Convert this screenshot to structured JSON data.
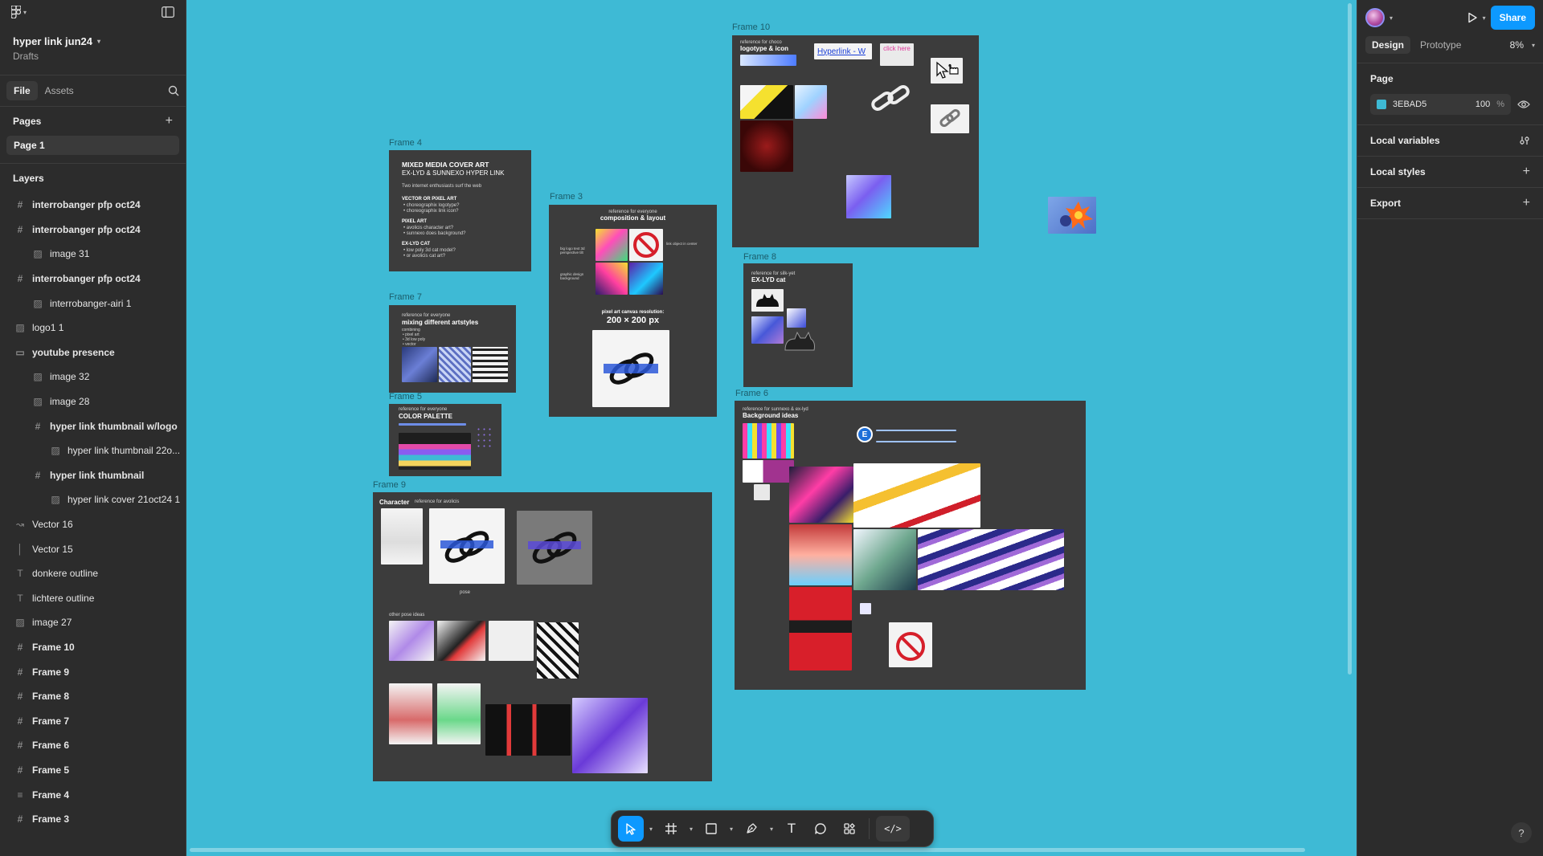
{
  "file": {
    "title": "hyper link jun24",
    "location": "Drafts"
  },
  "left_tabs": {
    "file": "File",
    "assets": "Assets"
  },
  "pages": {
    "header": "Pages",
    "items": [
      {
        "label": "Page 1"
      }
    ]
  },
  "layers": {
    "header": "Layers",
    "items": [
      {
        "label": "interrobanger pfp oct24",
        "icon": "frame-icon",
        "indent": 0
      },
      {
        "label": "interrobanger pfp oct24",
        "icon": "frame-icon",
        "indent": 0
      },
      {
        "label": "image 31",
        "icon": "image-icon",
        "indent": 1
      },
      {
        "label": "interrobanger pfp oct24",
        "icon": "frame-icon",
        "indent": 0
      },
      {
        "label": "interrobanger-airi 1",
        "icon": "image-icon",
        "indent": 1
      },
      {
        "label": "logo1 1",
        "icon": "image-icon",
        "indent": 0
      },
      {
        "label": "youtube presence",
        "icon": "section-icon",
        "indent": 0
      },
      {
        "label": "image 32",
        "icon": "image-icon",
        "indent": 1
      },
      {
        "label": "image 28",
        "icon": "image-icon",
        "indent": 1
      },
      {
        "label": "hyper link thumbnail w/logo",
        "icon": "frame-icon",
        "indent": 1
      },
      {
        "label": "hyper link thumbnail 22o...",
        "icon": "image-icon",
        "indent": 2
      },
      {
        "label": "hyper link thumbnail",
        "icon": "frame-icon",
        "indent": 1
      },
      {
        "label": "hyper link cover 21oct24 1",
        "icon": "image-icon",
        "indent": 2
      },
      {
        "label": "Vector 16",
        "icon": "vector-icon",
        "indent": 0
      },
      {
        "label": "Vector 15",
        "icon": "line-icon",
        "indent": 0
      },
      {
        "label": "donkere outline",
        "icon": "text-icon",
        "indent": 0
      },
      {
        "label": "lichtere outline",
        "icon": "text-icon",
        "indent": 0
      },
      {
        "label": "image 27",
        "icon": "image-icon",
        "indent": 0
      },
      {
        "label": "Frame 10",
        "icon": "frame-icon",
        "indent": 0
      },
      {
        "label": "Frame 9",
        "icon": "frame-icon",
        "indent": 0
      },
      {
        "label": "Frame 8",
        "icon": "frame-icon",
        "indent": 0
      },
      {
        "label": "Frame 7",
        "icon": "frame-icon",
        "indent": 0
      },
      {
        "label": "Frame 6",
        "icon": "frame-icon",
        "indent": 0
      },
      {
        "label": "Frame 5",
        "icon": "frame-icon",
        "indent": 0
      },
      {
        "label": "Frame 4",
        "icon": "autolayout-icon",
        "indent": 0
      },
      {
        "label": "Frame 3",
        "icon": "frame-icon",
        "indent": 0
      }
    ]
  },
  "canvas": {
    "background": "#3EBAD5",
    "frames": {
      "frame4": {
        "label": "Frame 4",
        "title1": "MIXED MEDIA COVER ART",
        "title2": "EX-LYD & SUNNEXO HYPER LINK",
        "intro": "Two internet enthusiasts surf the web",
        "sec1": "VECTOR OR PIXEL ART",
        "sec1a": "• choreographix logotype?",
        "sec1b": "• choreographix link icon?",
        "sec2": "PIXEL ART",
        "sec2a": "• avolicis character art?",
        "sec2b": "• sunnexo does background?",
        "sec3": "EX-LYD CAT",
        "sec3a": "• low poly 3d cat model?",
        "sec3b": "• or avolicis cat art?"
      },
      "frame7": {
        "label": "Frame 7",
        "sub": "reference for everyone",
        "title": "mixing different artstyles",
        "l1": "combining",
        "l2": "• pixel art",
        "l3": "• 3d low poly",
        "l4": "• vector"
      },
      "frame5": {
        "label": "Frame 5",
        "sub": "reference for everyone",
        "title": "COLOR PALETTE"
      },
      "frame3": {
        "label": "Frame 3",
        "sub": "reference for everyone",
        "title": "composition & layout",
        "note1": "big logo text 3d perspective tilt",
        "note2": "graphic design background",
        "note3": "link object in center",
        "canvas_note": "pixel art canvas resolution:",
        "canvas_size": "200 × 200 px"
      },
      "frame10": {
        "label": "Frame 10",
        "sub": "reference for choco",
        "title": "logotype & icon",
        "link_text": "Hyperlink - W",
        "click_text": "click here"
      },
      "frame8": {
        "label": "Frame 8",
        "sub": "reference for silk-yet",
        "title": "EX-LYD cat"
      },
      "frame6": {
        "label": "Frame 6",
        "sub": "reference for sunnexo & ex-lyd",
        "title": "Background ideas",
        "user_initial": "E"
      },
      "frame9": {
        "label": "Frame 9",
        "title": "Character",
        "sub": "reference for avolicis",
        "pose": "pose",
        "other": "other pose ideas"
      }
    }
  },
  "toolbar": {
    "move": "move-tool",
    "frame": "frame-tool",
    "shape": "rectangle-tool",
    "pen": "pen-tool",
    "text": "T",
    "comment": "comment-tool",
    "actions": "actions-tool",
    "dev": "</>"
  },
  "right": {
    "share": "Share",
    "tab_design": "Design",
    "tab_prototype": "Prototype",
    "zoom": "8%",
    "page_header": "Page",
    "page_color": "3EBAD5",
    "page_opacity": "100",
    "pct": "%",
    "local_variables": "Local variables",
    "local_styles": "Local styles",
    "export": "Export",
    "help": "?"
  },
  "colors": {
    "accent": "#0D99FF",
    "canvas": "#3EBAD5",
    "panel": "#2C2C2C",
    "frame": "#3C3C3C"
  }
}
